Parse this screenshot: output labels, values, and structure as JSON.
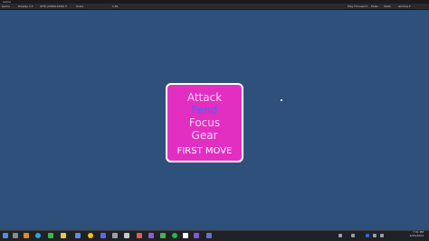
{
  "window": {
    "title": "Game"
  },
  "game_toolbar": {
    "tab": "Game",
    "display": "Display 1",
    "resolution": "QHD (2560x1440)",
    "scale": "Scale",
    "scale_value": "1.8x",
    "play_mode": "Play Focused",
    "mute": "Mute",
    "stats": "Stats",
    "gizmos": "Gizmos"
  },
  "menu": {
    "items": [
      {
        "label": "Attack",
        "selected": false
      },
      {
        "label": "Fend",
        "selected": true
      },
      {
        "label": "Focus",
        "selected": false
      },
      {
        "label": "Gear",
        "selected": false
      }
    ],
    "title": "FIRST MOVE"
  },
  "colors": {
    "background": "#30507c",
    "card": "#e32ec2",
    "card_border": "#ffffff",
    "item_text": "#f2d6ee",
    "selected_text": "#3d6cf2"
  },
  "taskbar": {
    "time": "7:31 PM",
    "date": "6/25/2024",
    "icons": [
      "windows-icon",
      "search-icon",
      "task-view-icon",
      "edge-icon",
      "folder-icon",
      "store-icon",
      "mail-icon",
      "chrome-icon",
      "discord-icon",
      "steam-icon",
      "unity-hub-icon",
      "unity-icon",
      "visual-studio-icon",
      "github-icon",
      "spotify-icon",
      "terminal-icon",
      "photos-icon",
      "settings-icon",
      "unity-editor-icon",
      "rider-icon",
      "visual-studio-active-icon",
      "app-icon"
    ]
  }
}
